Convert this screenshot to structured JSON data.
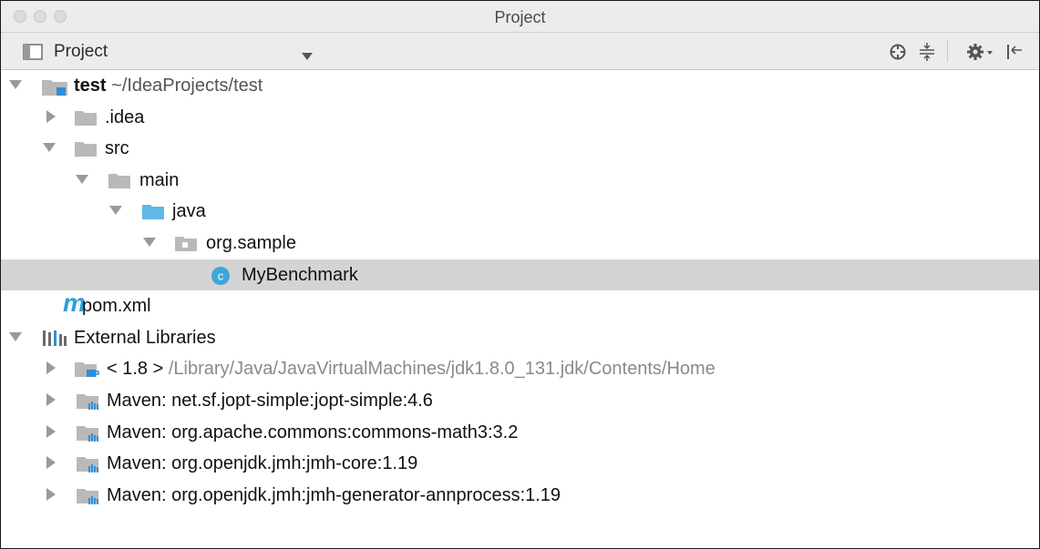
{
  "window": {
    "title": "Project"
  },
  "toolbar": {
    "view_label": "Project"
  },
  "tree": {
    "root": {
      "name": "test",
      "path": "~/IdeaProjects/test"
    },
    "idea": ".idea",
    "src": "src",
    "main": "main",
    "java": "java",
    "package": "org.sample",
    "class_file": "MyBenchmark",
    "class_badge": "c",
    "pom": "pom.xml",
    "pom_badge": "m",
    "external_libraries": "External Libraries",
    "sdk": {
      "name": "< 1.8 >",
      "path": "/Library/Java/JavaVirtualMachines/jdk1.8.0_131.jdk/Contents/Home"
    },
    "libraries": [
      "Maven: net.sf.jopt-simple:jopt-simple:4.6",
      "Maven: org.apache.commons:commons-math3:3.2",
      "Maven: org.openjdk.jmh:jmh-core:1.19",
      "Maven: org.openjdk.jmh:jmh-generator-annprocess:1.19"
    ]
  },
  "colors": {
    "selection": "#d4d4d4",
    "folder": "#b9b9b9",
    "source_folder": "#5fb8e6",
    "class_badge": "#3fa5d8",
    "maven_m": "#2aa0d9"
  }
}
